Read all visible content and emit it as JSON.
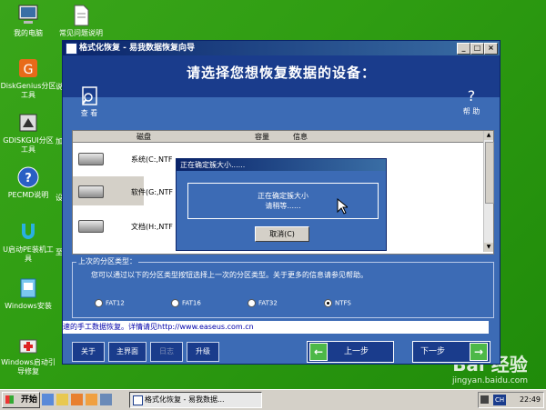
{
  "desktop": {
    "icons": [
      {
        "label": "我的电脑",
        "icon": "computer-icon"
      },
      {
        "label": "常见问题说明",
        "icon": "document-icon"
      },
      {
        "label": "DiskGenius分区工具",
        "icon": "diskgenius-icon"
      },
      {
        "label": "GDISKGUI分区工具",
        "icon": "gdisk-icon"
      },
      {
        "label": "PECMD说明",
        "icon": "help-icon"
      },
      {
        "label": "U启动PE装机工具",
        "icon": "installer-icon"
      },
      {
        "label": "Windows安装",
        "icon": "windows-install-icon"
      },
      {
        "label": "Windows启动引导修复",
        "icon": "boot-repair-icon"
      }
    ],
    "partial_labels": [
      "加",
      "说",
      "设",
      "至"
    ],
    "watermark": {
      "logo": "Bai 经验",
      "url": "jingyan.baidu.com"
    }
  },
  "window": {
    "title": "格式化恢复 - 易我数据恢复向导",
    "header_title": "请选择您想恢复数据的设备：",
    "view_label": "查 看",
    "help_label": "帮 助",
    "columns": [
      "磁盘",
      "容量",
      "信息"
    ],
    "rows": [
      {
        "name": "系统(C:,NTF",
        "icon": "hard-drive-icon"
      },
      {
        "name": "软件(G:,NTF",
        "icon": "hard-drive-icon",
        "selected": true
      },
      {
        "name": "文档(H:,NTF",
        "icon": "hard-drive-icon"
      }
    ],
    "group_title": "上次的分区类型：",
    "group_desc": "您可以通过以下的分区类型按钮选择上一次的分区类型。关于更多的信息请参见帮助。",
    "fs_options": [
      "FAT12",
      "FAT16",
      "FAT32",
      "NTFS"
    ],
    "fs_selected": "NTFS",
    "link_text": "速的手工数据恢复。详情请见http://www.easeus.com.cn",
    "buttons": {
      "about": "关于",
      "main": "主界面",
      "log": "日志",
      "upgrade": "升级"
    },
    "prev": "上一步",
    "next": "下一步"
  },
  "dialog": {
    "title": "正在确定簇大小......",
    "message_1": "正在确定簇大小",
    "message_2": "请稍等......",
    "cancel": "取消(C)"
  },
  "taskbar": {
    "start": "开始",
    "task_title": "格式化恢复 - 易我数据...",
    "ime": "CH",
    "time": "22:49"
  }
}
